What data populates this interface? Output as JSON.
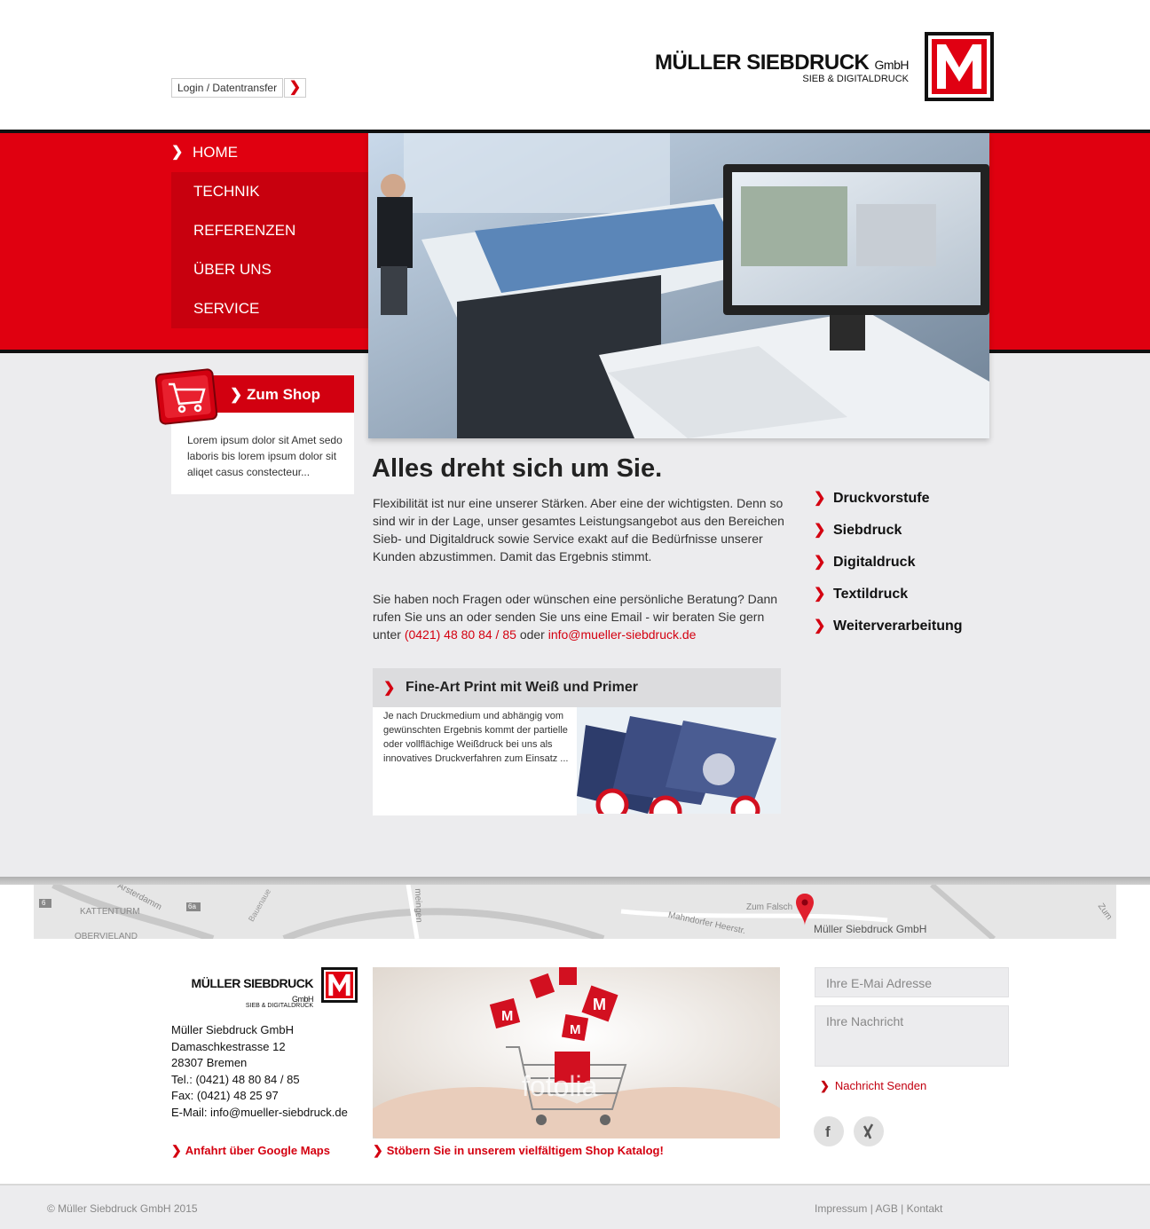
{
  "header": {
    "login_label": "Login / Datentransfer",
    "login_arrow": "❯",
    "logo_name": "MÜLLER SIEBDRUCK",
    "logo_suffix": "GmbH",
    "logo_sub": "SIEB & DIGITALDRUCK"
  },
  "nav": {
    "items": [
      {
        "label": "HOME",
        "active": true
      },
      {
        "label": "TECHNIK"
      },
      {
        "label": "REFERENZEN"
      },
      {
        "label": "ÜBER UNS"
      },
      {
        "label": "SERVICE"
      }
    ]
  },
  "shop": {
    "label": "Zum Shop",
    "text": "Lorem ipsum dolor sit Amet sedo laboris bis lorem ipsum dolor sit aliqet casus constecteur..."
  },
  "main": {
    "title": "Alles dreht sich um Sie.",
    "p1": "Flexibilität ist nur eine unserer Stärken. Aber eine der wichtigsten. Denn so sind wir in der Lage, unser gesamtes Leistungsangebot aus den Bereichen Sieb- und Digitaldruck sowie Service exakt auf die Bedürfnisse unserer Kunden abzustimmen. Damit das Ergebnis stimmt.",
    "p2_pre": "Sie haben noch Fragen oder wünschen eine persönliche Beratung? Dann rufen Sie uns an oder senden Sie uns eine Email - wir beraten Sie gern unter",
    "phone": "(0421) 48 80 84 / 85",
    "p2_mid": "oder",
    "email": "info@mueller-siebdruck.de"
  },
  "services": [
    "Druckvorstufe",
    "Siebdruck",
    "Digitaldruck",
    "Textildruck",
    "Weiterverarbeitung"
  ],
  "card": {
    "title": "Fine-Art Print mit Weiß und Primer",
    "text": "Je nach Druckmedium und abhängig vom gewünschten Ergebnis kommt der partielle oder vollflächige Weißdruck bei uns als innovatives Druckverfahren zum Einsatz ..."
  },
  "map": {
    "labels": [
      "6",
      "KATTENTURM",
      "Arsterdamm",
      "6a",
      "Bauenaue",
      "OBERVIELAND",
      "meingen",
      "Mahndorfer Heerstr.",
      "Zum Falsch",
      "Zum"
    ],
    "marker_label": "Müller Siebdruck GmbH"
  },
  "footer": {
    "logo_name": "MÜLLER SIEBDRUCK",
    "logo_suffix": "GmbH",
    "logo_sub": "SIEB & DIGITALDRUCK",
    "address": [
      "Müller Siebdruck GmbH",
      "Damaschkestrasse 12",
      "28307 Bremen",
      "Tel.: (0421) 48 80 84 / 85",
      "Fax: (0421) 48 25 97",
      "E-Mail: info@mueller-siebdruck.de"
    ],
    "maps_link": "Anfahrt über Google Maps",
    "shop_link": "Stöbern Sie in unserem vielfältigem Shop Katalog!",
    "email_placeholder": "Ihre E-Mai Adresse",
    "message_placeholder": "Ihre Nachricht",
    "send_label": "Nachricht Senden",
    "watermark": "fotolia",
    "social": [
      "facebook-icon",
      "xing-icon"
    ]
  },
  "bottom": {
    "copyright": "© Müller Siebdruck GmbH 2015",
    "links": [
      "Impressum",
      "AGB",
      "Kontakt"
    ],
    "separator": "|"
  },
  "colors": {
    "brand_red": "#e00010",
    "dark": "#111111",
    "bg": "#ececee"
  }
}
